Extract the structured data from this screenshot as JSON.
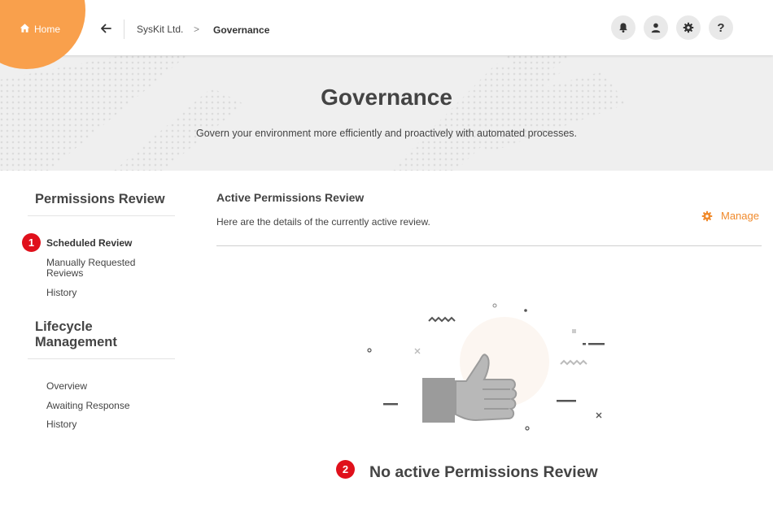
{
  "topbar": {
    "home_label": "Home",
    "breadcrumb": [
      "SysKit Ltd.",
      "Governance"
    ],
    "breadcrumb_separator": ">",
    "icons": [
      "bell-icon",
      "user-icon",
      "gear-icon",
      "help-icon"
    ],
    "help_glyph": "?",
    "brand_color": "#f9a04c"
  },
  "hero": {
    "title": "Governance",
    "subtitle": "Govern your environment more efficiently and proactively with automated processes."
  },
  "sidebar": {
    "sections": [
      {
        "heading": "Permissions Review",
        "items": [
          "Scheduled Review",
          "Manually Requested Reviews",
          "History"
        ]
      },
      {
        "heading": "Lifecycle Management",
        "items": [
          "Overview",
          "Awaiting Response",
          "History"
        ]
      }
    ],
    "active_item": "Scheduled Review"
  },
  "main": {
    "title": "Active Permissions Review",
    "subtitle": "Here are the details of the currently active review.",
    "manage_label": "Manage",
    "empty_state": "No active Permissions Review",
    "accent_color": "#f08a2c"
  },
  "annotations": {
    "badge_1": "1",
    "badge_2": "2",
    "badge_color": "#e0101b"
  }
}
